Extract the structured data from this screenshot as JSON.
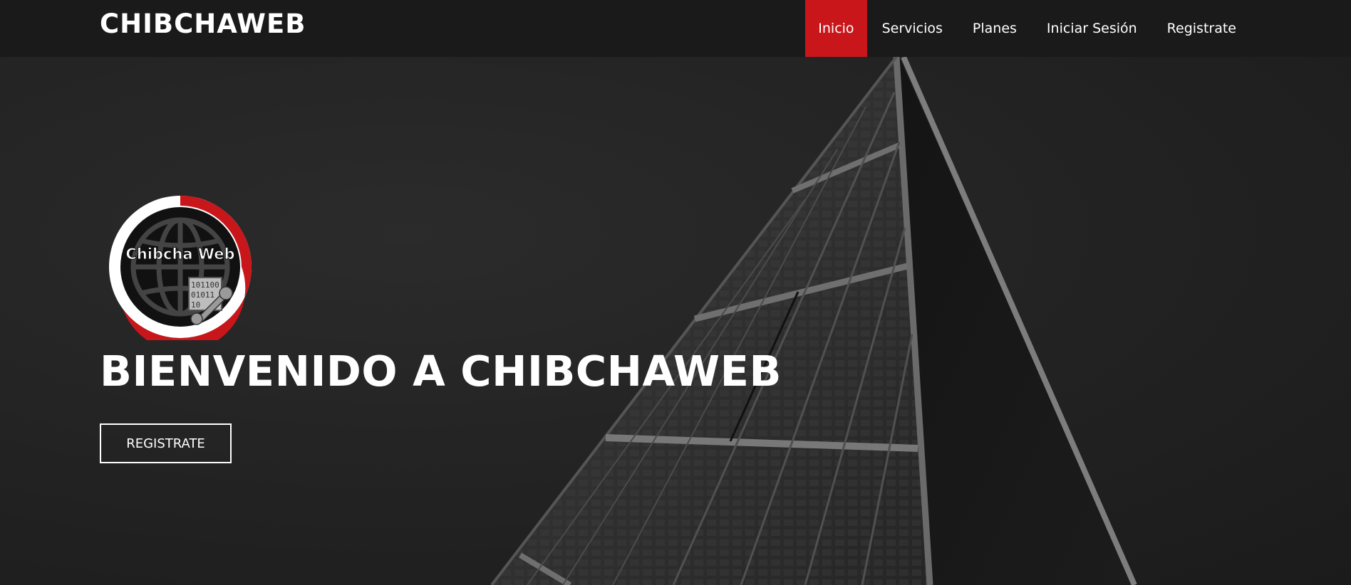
{
  "navbar": {
    "brand": "CHIBCHAWEB",
    "items": [
      {
        "label": "Inicio",
        "active": true
      },
      {
        "label": "Servicios",
        "active": false
      },
      {
        "label": "Planes",
        "active": false
      },
      {
        "label": "Iniciar Sesión",
        "active": false
      },
      {
        "label": "Registrate",
        "active": false
      }
    ]
  },
  "hero": {
    "logo": {
      "text": "Chibcha Web",
      "binary": [
        "101100",
        "01011",
        "10"
      ]
    },
    "headline": "BIENVENIDO A CHIBCHAWEB",
    "cta_label": "REGISTRATE"
  },
  "colors": {
    "accent": "#c8161b",
    "navbar_bg": "#1a1a1a",
    "hero_bg": "#222222",
    "text": "#ffffff"
  }
}
